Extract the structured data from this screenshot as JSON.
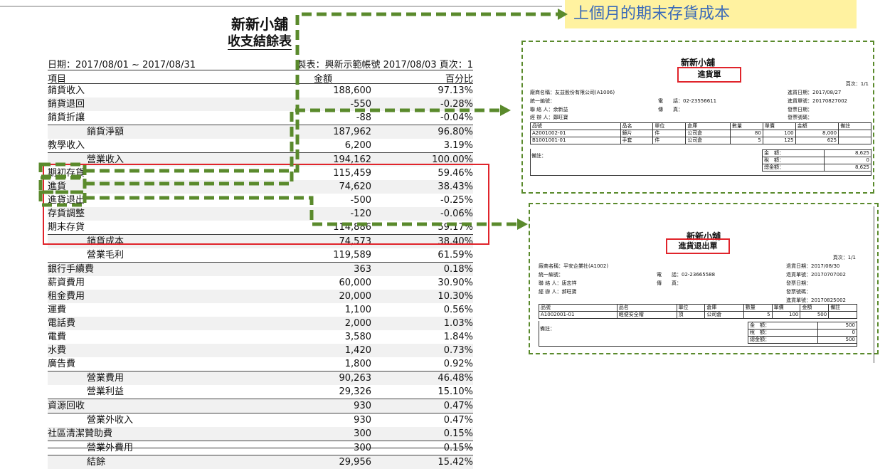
{
  "annotation": {
    "text": "上個月的期末存貨成本"
  },
  "report": {
    "store": "新新小舖",
    "title": "收支結餘表",
    "date_range": "日期：2017/08/01 ~ 2017/08/31",
    "maker": "製表：興新示範帳號 2017/08/03 頁次：1",
    "col_item": "項目",
    "col_amount": "金額",
    "col_percent": "百分比",
    "rows": [
      {
        "label": "銷貨收入",
        "amount": "188,600",
        "pct": "97.13%",
        "ind": false,
        "sep": false
      },
      {
        "label": "銷貨退回",
        "amount": "-550",
        "pct": "-0.28%",
        "ind": false,
        "sep": false
      },
      {
        "label": "銷貨折讓",
        "amount": "-88",
        "pct": "-0.04%",
        "ind": false,
        "sep": false
      },
      {
        "label": "銷貨淨額",
        "amount": "187,962",
        "pct": "96.80%",
        "ind": true,
        "sep": true
      },
      {
        "label": "教學收入",
        "amount": "6,200",
        "pct": "3.19%",
        "ind": false,
        "sep": false
      },
      {
        "label": "營業收入",
        "amount": "194,162",
        "pct": "100.00%",
        "ind": true,
        "sep": true
      },
      {
        "label": "期初存貨",
        "amount": "115,459",
        "pct": "59.46%",
        "ind": false,
        "sep": false
      },
      {
        "label": "進貨",
        "amount": "74,620",
        "pct": "38.43%",
        "ind": false,
        "sep": false
      },
      {
        "label": "進貨退出",
        "amount": "-500",
        "pct": "-0.25%",
        "ind": false,
        "sep": false
      },
      {
        "label": "存貨調整",
        "amount": "-120",
        "pct": "-0.06%",
        "ind": false,
        "sep": false
      },
      {
        "label": "期末存貨",
        "amount": "114,886",
        "pct": "59.17%",
        "ind": false,
        "sep": false
      },
      {
        "label": "銷貨成本",
        "amount": "74,573",
        "pct": "38.40%",
        "ind": true,
        "sep": true
      },
      {
        "label": "營業毛利",
        "amount": "119,589",
        "pct": "61.59%",
        "ind": true,
        "sep": false
      },
      {
        "label": "銀行手續費",
        "amount": "363",
        "pct": "0.18%",
        "ind": false,
        "sep": true
      },
      {
        "label": "薪資費用",
        "amount": "60,000",
        "pct": "30.90%",
        "ind": false,
        "sep": false
      },
      {
        "label": "租金費用",
        "amount": "20,000",
        "pct": "10.30%",
        "ind": false,
        "sep": false
      },
      {
        "label": "運費",
        "amount": "1,100",
        "pct": "0.56%",
        "ind": false,
        "sep": false
      },
      {
        "label": "電話費",
        "amount": "2,000",
        "pct": "1.03%",
        "ind": false,
        "sep": false
      },
      {
        "label": "電費",
        "amount": "3,580",
        "pct": "1.84%",
        "ind": false,
        "sep": false
      },
      {
        "label": "水費",
        "amount": "1,420",
        "pct": "0.73%",
        "ind": false,
        "sep": false
      },
      {
        "label": "廣告費",
        "amount": "1,800",
        "pct": "0.92%",
        "ind": false,
        "sep": false
      },
      {
        "label": "營業費用",
        "amount": "90,263",
        "pct": "46.48%",
        "ind": true,
        "sep": true
      },
      {
        "label": "營業利益",
        "amount": "29,326",
        "pct": "15.10%",
        "ind": true,
        "sep": false
      },
      {
        "label": "資源回收",
        "amount": "930",
        "pct": "0.47%",
        "ind": false,
        "sep": true
      },
      {
        "label": "營業外收入",
        "amount": "930",
        "pct": "0.47%",
        "ind": true,
        "sep": true
      },
      {
        "label": "社區清潔贊助費",
        "amount": "300",
        "pct": "0.15%",
        "ind": false,
        "sep": false
      },
      {
        "label": "營業外費用",
        "amount": "300",
        "pct": "0.15%",
        "ind": true,
        "sep": true
      },
      {
        "label": "結餘",
        "amount": "29,956",
        "pct": "15.42%",
        "ind": true,
        "sep": true
      }
    ]
  },
  "purchase_doc": {
    "store": "新新小舖",
    "title": "進貨單",
    "page": "頁次：1/1",
    "vendor": "廠商名稱：友益股份有限公司(A1006)",
    "tax_id": "統一編號：",
    "contact": "聯 絡 人：余新益",
    "handler": "經 辦 人：鄭旺寶",
    "phone": "電　　話：02-23556611",
    "fax": "傳　　真：",
    "date": "進貨日期：2017/08/27",
    "doc_no": "進貨單號：20170827002",
    "invoice_date": "發票日期：",
    "invoice_no": "發票號碼：",
    "headers": [
      "品號",
      "品名",
      "單位",
      "倉庫",
      "數量",
      "單價",
      "金額",
      "備註"
    ],
    "items": [
      [
        "A2001002-01",
        "鏡片",
        "件",
        "公司倉",
        "80",
        "100",
        "8,000",
        ""
      ],
      [
        "B1001001-01",
        "手套",
        "件",
        "公司倉",
        "5",
        "125",
        "625",
        ""
      ]
    ],
    "note": "備註：",
    "sum_labels": [
      "金　額：",
      "稅　額：",
      "總金額："
    ],
    "sum_values": [
      "8,625",
      "0",
      "8,625"
    ]
  },
  "return_doc": {
    "store": "新新小舖",
    "title": "進貨退出單",
    "page": "頁次：1/1",
    "vendor": "廠商名稱：平安企業社(A1002)",
    "tax_id": "統一編號：",
    "contact": "聯 絡 人：唐志祥",
    "handler": "經 辦 人：郝旺寶",
    "phone": "電　　話：02-23665588",
    "fax": "傳　　真：",
    "date": "退貨日期：2017/08/30",
    "doc_no": "退貨單號：20170707002",
    "invoice_date": "發票日期：",
    "invoice_no": "發票號碼：",
    "purchase_no": "進貨單號：20170825002",
    "headers": [
      "品號",
      "品名",
      "單位",
      "倉庫",
      "數量",
      "單價",
      "金額",
      "備註"
    ],
    "items": [
      [
        "A1002001-01",
        "輕便安全帽",
        "頂",
        "公司倉",
        "5",
        "100",
        "500",
        ""
      ]
    ],
    "note": "備註：",
    "sum_labels": [
      "金　額：",
      "稅　額：",
      "總金額："
    ],
    "sum_values": [
      "500",
      "0",
      "500"
    ]
  }
}
